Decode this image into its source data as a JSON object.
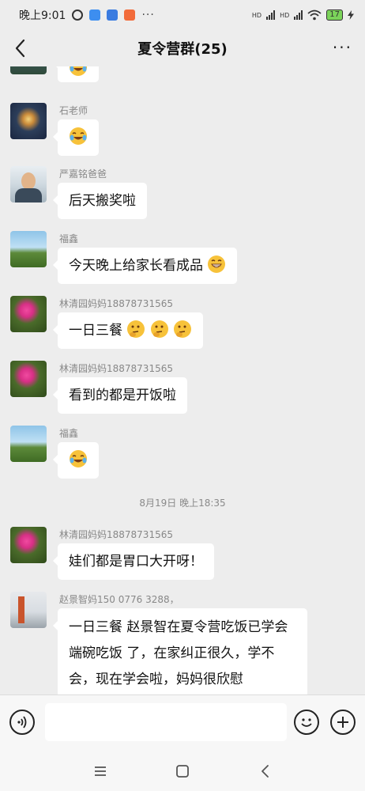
{
  "status_bar": {
    "time": "晚上9:01",
    "more_dots": "···",
    "network_1": "HD",
    "network_2": "HD",
    "battery": "17"
  },
  "header": {
    "title": "夏令营群(25)",
    "more_label": "···"
  },
  "messages": [
    {
      "name": "",
      "text": ""
    },
    {
      "name": "石老师",
      "text": ""
    },
    {
      "name": "严嘉铭爸爸",
      "text": "后天搬奖啦"
    },
    {
      "name": "福鑫",
      "text": "今天晚上给家长看成品"
    },
    {
      "name": "林清园妈妈18878731565",
      "text": "一日三餐"
    },
    {
      "name": "林清园妈妈18878731565",
      "text": "看到的都是开饭啦"
    },
    {
      "name": "福鑫",
      "text": ""
    },
    {
      "name": "林清园妈妈18878731565",
      "text": "娃们都是胃口大开呀！"
    },
    {
      "name": "赵景智妈150 0776 3288，",
      "text": "一日三餐  赵景智在夏令营吃饭已学会 端碗吃饭 了，在家纠正很久，学不会，现在学会啦，妈妈很欣慰"
    }
  ],
  "timestamp": "8月19日 晚上18:35",
  "input": {
    "placeholder": ""
  },
  "colors": {
    "background": "#ededed",
    "bubble": "#ffffff",
    "name": "#888888"
  }
}
